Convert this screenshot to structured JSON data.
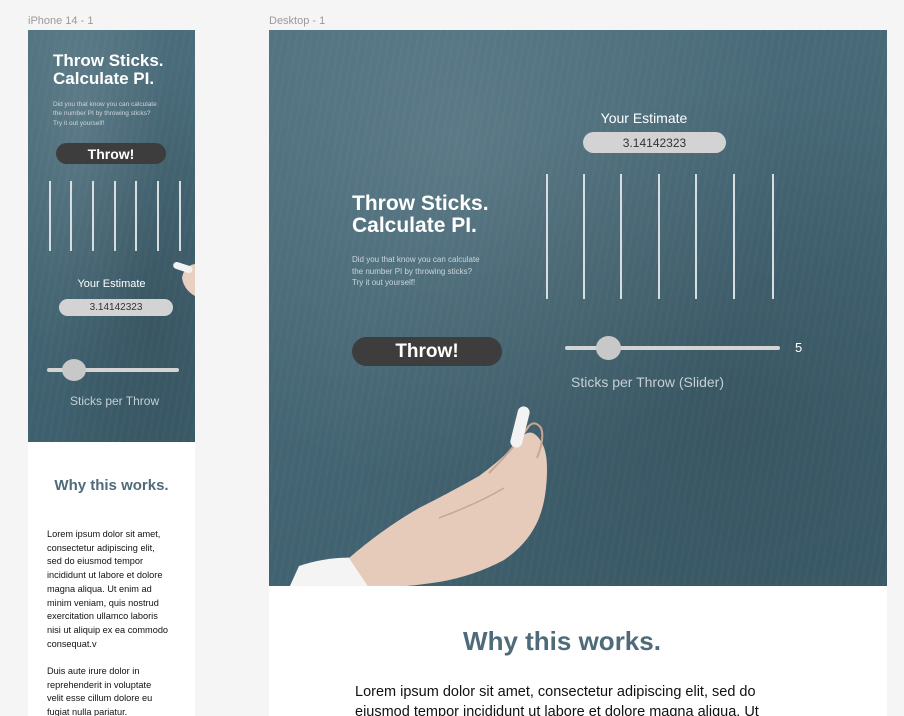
{
  "frames": {
    "mobile_label": "iPhone 14 - 1",
    "desktop_label": "Desktop - 1"
  },
  "hero": {
    "title_line1": "Throw Sticks.",
    "title_line2": "Calculate PI.",
    "desc_line1": "Did you that know you can calculate",
    "desc_line2": "the number PI by throwing sticks?",
    "desc_line3": "Try it out yourself!",
    "throw_label": "Throw!",
    "estimate_label": "Your Estimate",
    "estimate_value": "3.14142323",
    "slider_mobile_label": "Sticks per Throw",
    "slider_desktop_label": "Sticks per Throw (Slider)",
    "slider_value": "5"
  },
  "why": {
    "heading": "Why this works.",
    "mobile_para1": [
      "Lorem ipsum dolor sit amet,",
      "consectetur adipiscing elit,",
      "sed do eiusmod tempor",
      "incididunt ut labore et dolore",
      "magna aliqua. Ut enim ad",
      "minim veniam, quis nostrud",
      "exercitation ullamco laboris",
      "nisi ut aliquip ex ea commodo",
      "consequat.v"
    ],
    "mobile_para2": [
      "Duis aute irure dolor in",
      "reprehenderit in voluptate",
      "velit esse cillum dolore eu",
      "fugiat nulla pariatur."
    ],
    "desktop_line1": "Lorem ipsum dolor sit amet, consectetur adipiscing elit, sed do",
    "desktop_line2": "eiusmod tempor incididunt ut labore et dolore magna aliqua. Ut"
  },
  "colors": {
    "board": "#456674",
    "button": "#3d3d3d",
    "heading": "#4f6b7a"
  }
}
